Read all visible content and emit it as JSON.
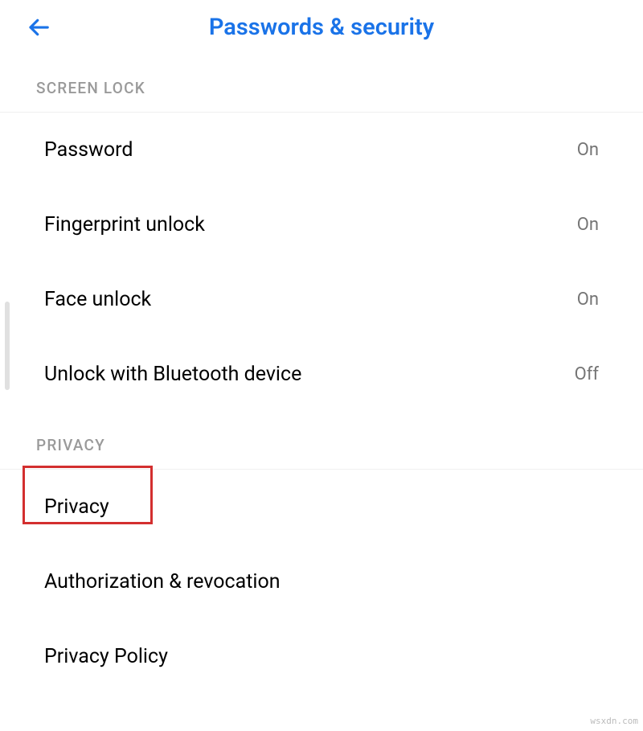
{
  "header": {
    "title": "Passwords & security"
  },
  "sections": {
    "screen_lock": {
      "title": "SCREEN LOCK",
      "items": [
        {
          "label": "Password",
          "status": "On"
        },
        {
          "label": "Fingerprint unlock",
          "status": "On"
        },
        {
          "label": "Face unlock",
          "status": "On"
        },
        {
          "label": "Unlock with Bluetooth device",
          "status": "Off"
        }
      ]
    },
    "privacy": {
      "title": "PRIVACY",
      "items": [
        {
          "label": "Privacy"
        },
        {
          "label": "Authorization & revocation"
        },
        {
          "label": "Privacy Policy"
        }
      ]
    }
  },
  "watermark": "wsxdn.com"
}
